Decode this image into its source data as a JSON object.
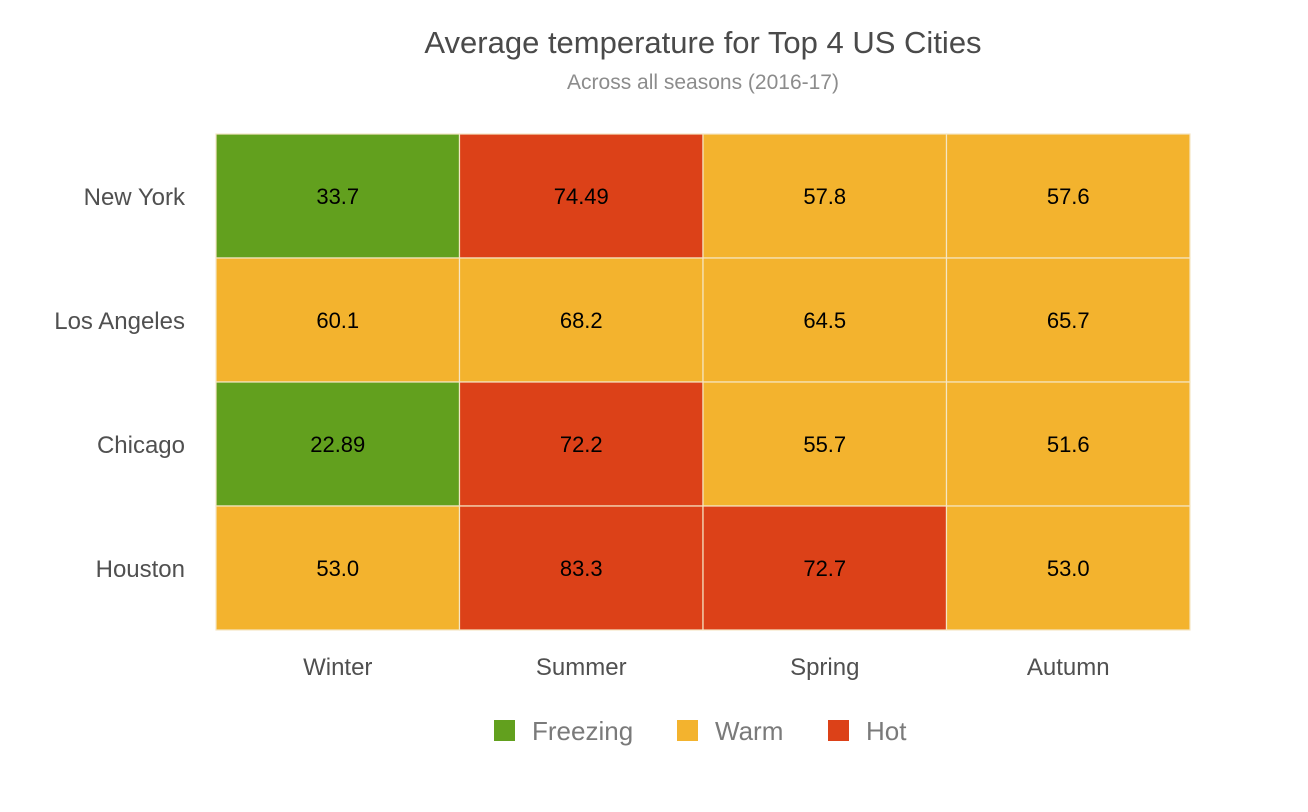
{
  "chart_data": {
    "type": "heatmap",
    "title": "Average temperature for Top 4 US Cities",
    "subtitle": "Across all seasons (2016-17)",
    "rows": [
      "New York",
      "Los Angeles",
      "Chicago",
      "Houston"
    ],
    "columns": [
      "Winter",
      "Summer",
      "Spring",
      "Autumn"
    ],
    "values": [
      [
        "33.7",
        "74.49",
        "57.8",
        "57.6"
      ],
      [
        "60.1",
        "68.2",
        "64.5",
        "65.7"
      ],
      [
        "22.89",
        "72.2",
        "55.7",
        "51.6"
      ],
      [
        "53.0",
        "83.3",
        "72.7",
        "53.0"
      ]
    ],
    "categories_per_cell": [
      [
        "Freezing",
        "Hot",
        "Warm",
        "Warm"
      ],
      [
        "Warm",
        "Warm",
        "Warm",
        "Warm"
      ],
      [
        "Freezing",
        "Hot",
        "Warm",
        "Warm"
      ],
      [
        "Warm",
        "Hot",
        "Hot",
        "Warm"
      ]
    ],
    "legend": [
      {
        "label": "Freezing",
        "color": "#62A01E"
      },
      {
        "label": "Warm",
        "color": "#F3B32E"
      },
      {
        "label": "Hot",
        "color": "#DC4118"
      }
    ],
    "legend_position": "bottom-center",
    "grid_line_color": "#F5E6C4"
  }
}
